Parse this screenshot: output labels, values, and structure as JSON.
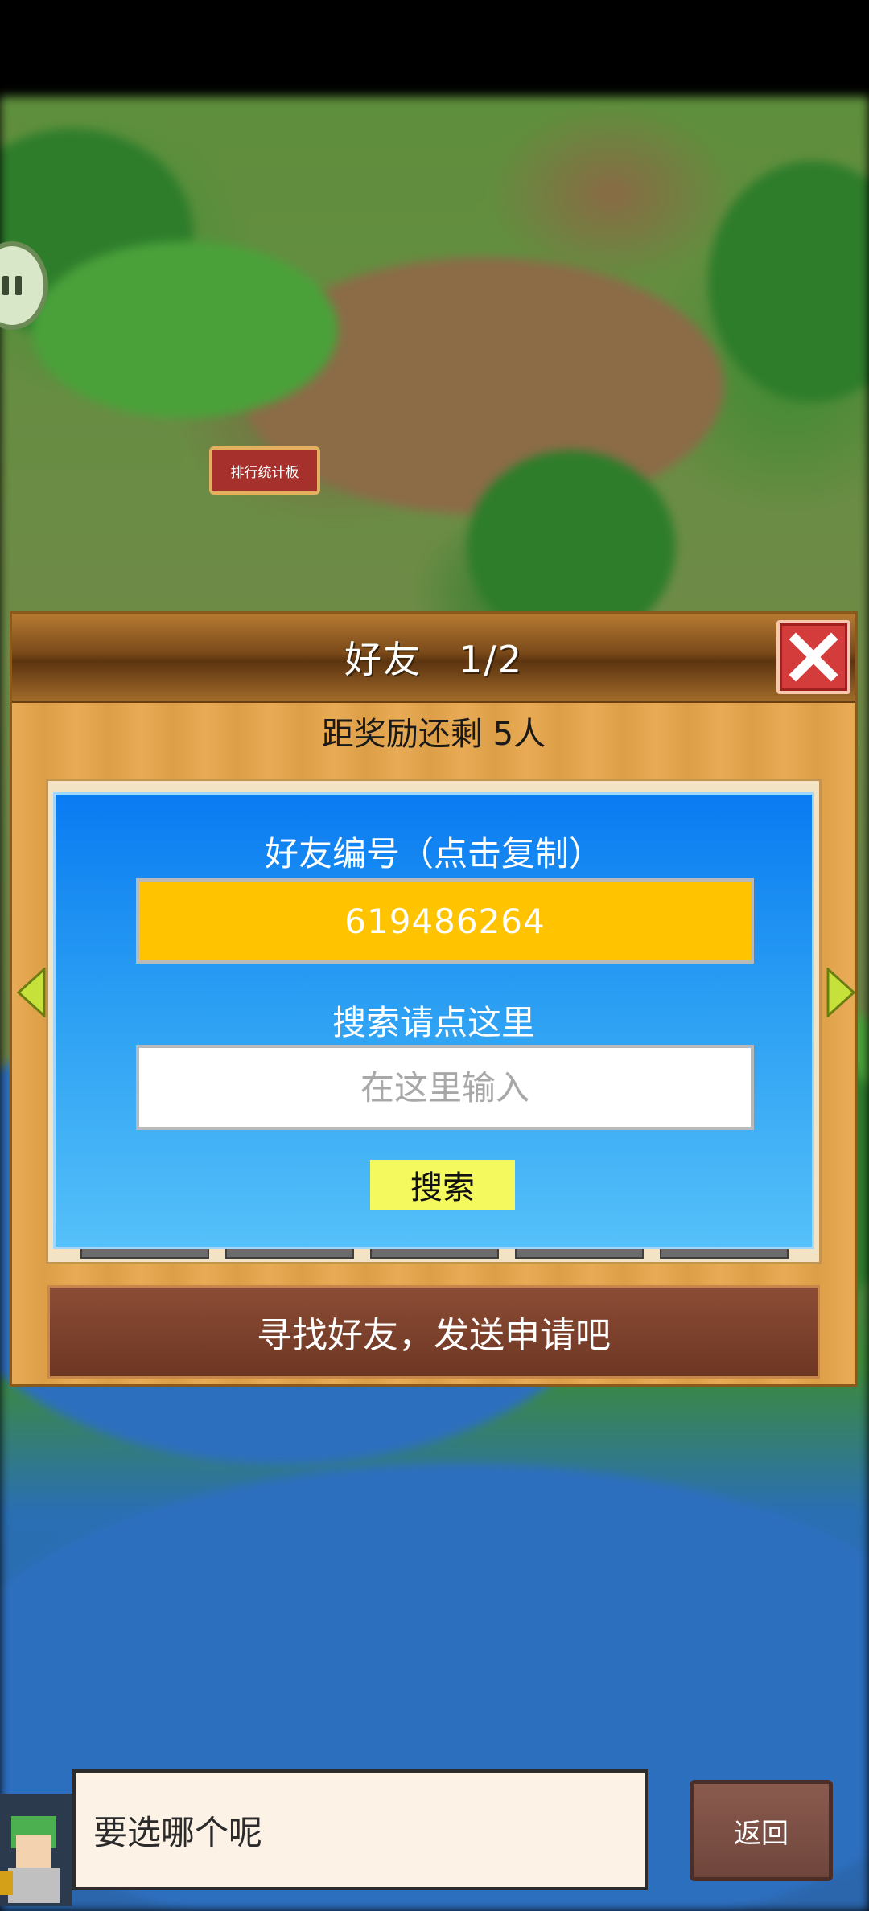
{
  "scene": {
    "sign_label": "排行统计板"
  },
  "dialog": {
    "title": "好友",
    "page_indicator": "1/2",
    "reward_text": "距奖励还剩 5人",
    "friend_id_label": "好友编号（点击复制）",
    "friend_id_value": "619486264",
    "search_label": "搜索请点这里",
    "search_placeholder": "在这里输入",
    "search_button": "搜索",
    "find_button": "寻找好友，发送申请吧"
  },
  "bottom": {
    "speech_text": "要选哪个呢",
    "back_button": "返回"
  },
  "colors": {
    "dialog_wood": "#e8a64a",
    "panel_blue": "#0a7bf2",
    "id_field": "#ffc300",
    "search_button": "#f4f95e",
    "close_red": "#d43c3c",
    "find_button": "#7a3f2a"
  },
  "icons": {
    "close": "close-icon",
    "prev": "arrow-left-icon",
    "next": "arrow-right-icon",
    "pause": "pause-icon"
  }
}
